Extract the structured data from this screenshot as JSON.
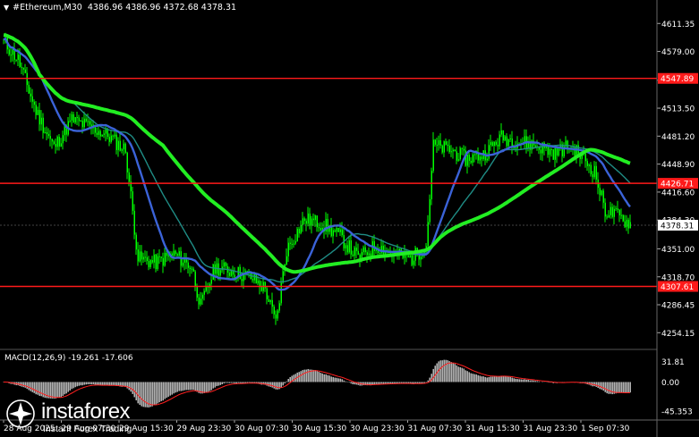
{
  "header": {
    "symbol_tf": "#Ethereum,M30",
    "ohlc": "4386.96 4386.96 4372.68 4378.31"
  },
  "colors": {
    "background": "#000000",
    "candle": "#00ff00",
    "ma_fast": "#3b63d8",
    "ma_mid": "#1f8c85",
    "ma_slow": "#22ee22",
    "level": "#ff1a1a",
    "macd_hist": "#c8c8c8",
    "macd_signal": "#ff2020",
    "grid": "#33444a",
    "axis_text": "#ffffff",
    "price_box": "#ffffff"
  },
  "price_axis": {
    "ticks": [
      "4611.35",
      "4579.00",
      "4545.80",
      "4513.50",
      "4481.20",
      "4448.90",
      "4416.60",
      "4384.30",
      "4351.00",
      "4318.70",
      "4286.45",
      "4254.15"
    ]
  },
  "levels": [
    {
      "label": "4547.89",
      "value": 4547.89
    },
    {
      "label": "4426.71",
      "value": 4426.71
    },
    {
      "label": "4307.61",
      "value": 4307.61
    }
  ],
  "current_price": {
    "label": "4378.31",
    "value": 4378.31
  },
  "macd": {
    "label": "MACD(12,26,9) -19.261 -17.606",
    "ticks": [
      "31.81",
      "0.00",
      "-45.353"
    ]
  },
  "time_axis": {
    "labels": [
      "28 Aug 2025",
      "29 Aug 07:30",
      "29 Aug 15:30",
      "29 Aug 23:30",
      "30 Aug 07:30",
      "30 Aug 15:30",
      "30 Aug 23:30",
      "31 Aug 07:30",
      "31 Aug 15:30",
      "31 Aug 23:30",
      "1 Sep 07:30"
    ]
  },
  "logo": {
    "brand": "instaforex",
    "tagline": "Instant Forex Trading"
  },
  "icons": {
    "menu_triangle": "triangle-down-icon",
    "logo_mark": "instaforex-logo-icon"
  }
}
